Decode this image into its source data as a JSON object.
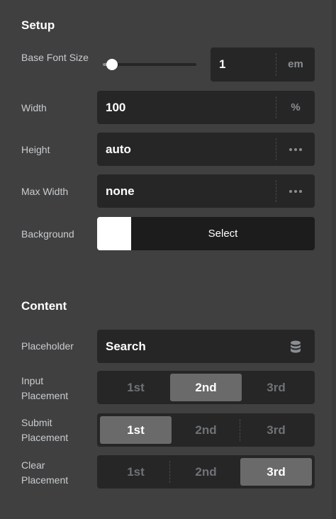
{
  "setup": {
    "title": "Setup",
    "base_font_size": {
      "label": "Base Font Size",
      "value": "1",
      "unit": "em",
      "slider_fraction": 0.1
    },
    "width": {
      "label": "Width",
      "value": "100",
      "unit": "%"
    },
    "height": {
      "label": "Height",
      "value": "auto",
      "menu_icon": "more-horizontal-icon"
    },
    "max_width": {
      "label": "Max Width",
      "value": "none",
      "menu_icon": "more-horizontal-icon"
    },
    "background": {
      "label": "Background",
      "swatch_color": "#ffffff",
      "select_label": "Select"
    }
  },
  "content": {
    "title": "Content",
    "placeholder": {
      "label": "Placeholder",
      "value": "Search",
      "icon": "database-icon"
    },
    "input_placement": {
      "label": "Input Placement",
      "options": [
        "1st",
        "2nd",
        "3rd"
      ],
      "selected": "2nd"
    },
    "submit_placement": {
      "label": "Submit Placement",
      "options": [
        "1st",
        "2nd",
        "3rd"
      ],
      "selected": "1st"
    },
    "clear_placement": {
      "label": "Clear Placement",
      "options": [
        "1st",
        "2nd",
        "3rd"
      ],
      "selected": "3rd"
    }
  },
  "colors": {
    "panel_bg": "#404040",
    "field_bg": "#262626",
    "active_segment": "#6a6a6a",
    "text": "#ffffff",
    "muted": "#8a8d91"
  }
}
